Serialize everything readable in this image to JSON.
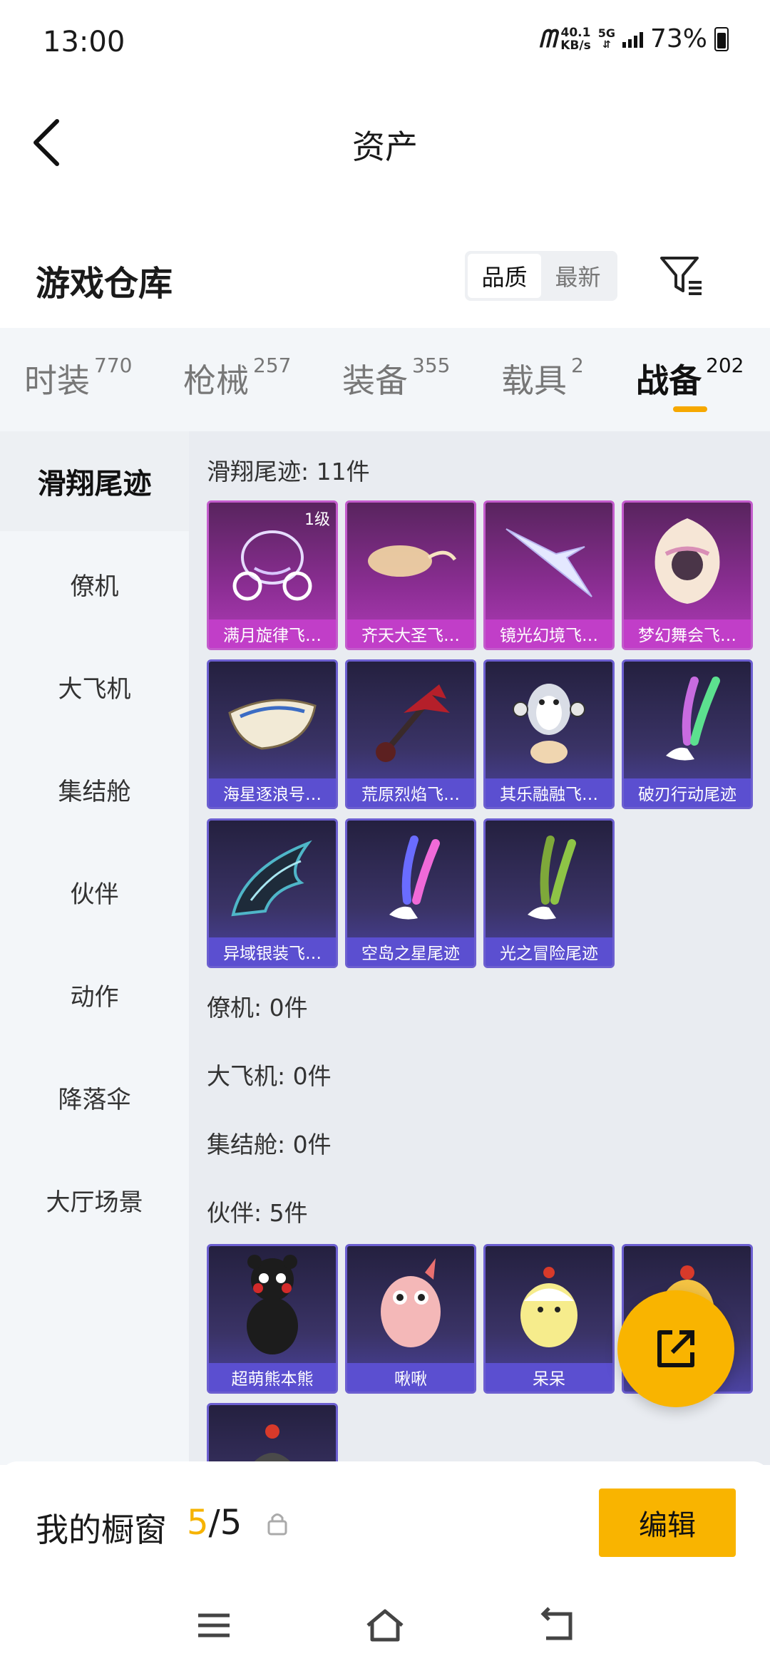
{
  "status_bar": {
    "time": "13:00",
    "net_logo": "ᗰ",
    "speed_value": "40.1",
    "speed_unit": "KB/s",
    "network": "5G",
    "battery": "73%"
  },
  "header": {
    "title": "资产"
  },
  "warehouse": {
    "title": "游戏仓库",
    "sort_quality": "品质",
    "sort_newest": "最新"
  },
  "tabs": [
    {
      "label": "时装",
      "count": "770"
    },
    {
      "label": "枪械",
      "count": "257"
    },
    {
      "label": "装备",
      "count": "355"
    },
    {
      "label": "载具",
      "count": "2"
    },
    {
      "label": "战备",
      "count": "202"
    }
  ],
  "sidebar": {
    "items": [
      "滑翔尾迹",
      "僚机",
      "大飞机",
      "集结舱",
      "伙伴",
      "动作",
      "降落伞",
      "大厅场景"
    ]
  },
  "sections": {
    "glide_trail": {
      "title": "滑翔尾迹: 11件",
      "cards": [
        {
          "label": "满月旋律飞…",
          "level": "1级"
        },
        {
          "label": "齐天大圣飞…"
        },
        {
          "label": "镜光幻境飞…"
        },
        {
          "label": "梦幻舞会飞…"
        },
        {
          "label": "海星逐浪号…"
        },
        {
          "label": "荒原烈焰飞…"
        },
        {
          "label": "其乐融融飞…"
        },
        {
          "label": "破刃行动尾迹"
        },
        {
          "label": "异域银装飞…"
        },
        {
          "label": "空岛之星尾迹"
        },
        {
          "label": "光之冒险尾迹"
        }
      ]
    },
    "wingman": {
      "title": "僚机: 0件"
    },
    "big_plane": {
      "title": "大飞机: 0件"
    },
    "pod": {
      "title": "集结舱: 0件"
    },
    "partner": {
      "title": "伙伴: 5件",
      "cards": [
        {
          "label": "超萌熊本熊"
        },
        {
          "label": "啾啾"
        },
        {
          "label": "呆呆"
        }
      ]
    }
  },
  "showcase": {
    "title": "我的橱窗",
    "count_current": "5",
    "count_total": "/5",
    "edit_label": "编辑"
  },
  "colors": {
    "accent": "#f9b400",
    "card_purple": "#c13ec8",
    "card_blue": "#5b4fd0"
  }
}
